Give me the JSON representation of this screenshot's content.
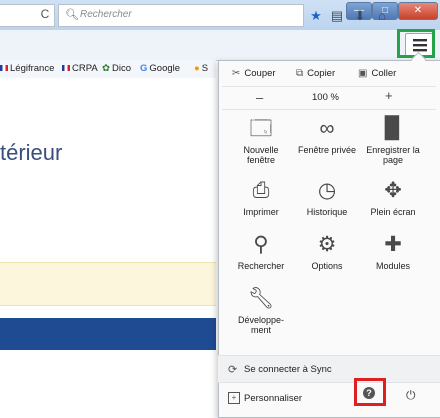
{
  "window": {
    "minimize": "—",
    "maximize": "□",
    "close": "✕"
  },
  "nav": {
    "reload": "C",
    "search_placeholder": "Rechercher",
    "icons": [
      "star-icon",
      "clipboard-icon",
      "download-icon",
      "home-icon",
      "hamburger-menu-icon"
    ]
  },
  "bookmarks": [
    "Légifrance",
    "CRPA",
    "Dico",
    "Google",
    "S"
  ],
  "page": {
    "heading": "térieur"
  },
  "menu": {
    "cut": "Couper",
    "copy": "Copier",
    "paste": "Coller",
    "zoom_minus": "–",
    "zoom_value": "100 %",
    "zoom_plus": "+",
    "tiles": [
      {
        "label": "Nouvelle\nfenêtre",
        "icon": "new-window-icon"
      },
      {
        "label": "Fenêtre privée",
        "icon": "private-mask-icon"
      },
      {
        "label": "Enregistrer la\npage",
        "icon": "save-page-icon"
      },
      {
        "label": "Imprimer",
        "icon": "print-icon"
      },
      {
        "label": "Historique",
        "icon": "history-clock-icon"
      },
      {
        "label": "Plein écran",
        "icon": "fullscreen-icon"
      },
      {
        "label": "Rechercher",
        "icon": "search-icon"
      },
      {
        "label": "Options",
        "icon": "gear-icon"
      },
      {
        "label": "Modules",
        "icon": "puzzle-icon"
      },
      {
        "label": "Développe-\nment",
        "icon": "wrench-icon"
      }
    ],
    "sync": "Se connecter à Sync",
    "customize": "Personnaliser"
  },
  "colors": {
    "accent_green": "#25a34a",
    "accent_red": "#e02020",
    "brand_blue": "#1f4b93"
  }
}
